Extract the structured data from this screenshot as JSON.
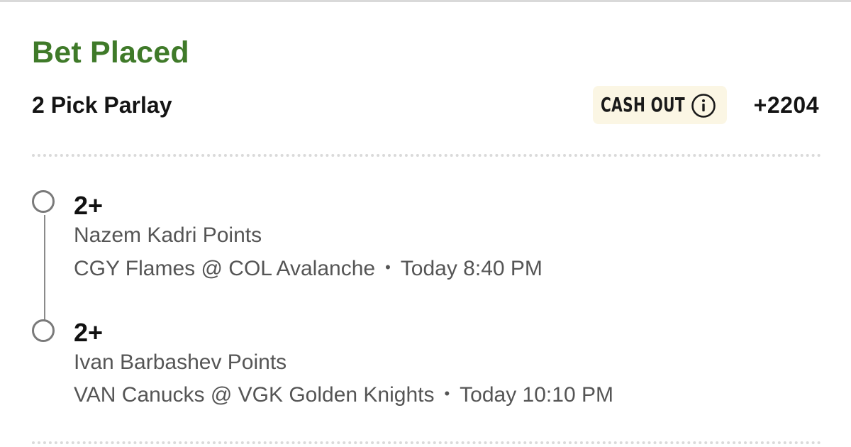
{
  "header": {
    "status": "Bet Placed",
    "bet_type": "2 Pick Parlay",
    "cash_out_label": "CASH OUT",
    "odds": "+2204"
  },
  "legs": [
    {
      "threshold": "2+",
      "market": "Nazem Kadri Points",
      "matchup": "CGY Flames @ COL Avalanche",
      "separator": "•",
      "time": "Today 8:40 PM"
    },
    {
      "threshold": "2+",
      "market": "Ivan Barbashev Points",
      "matchup": "VAN Canucks @ VGK Golden Knights",
      "separator": "•",
      "time": "Today 10:10 PM"
    }
  ],
  "colors": {
    "status_green": "#3f7a29",
    "cash_out_bg": "#fbf6e4",
    "text_primary": "#111111",
    "text_secondary": "#555555",
    "timeline_gray": "#7a7a7a"
  },
  "icons": {
    "info": "info-circle-icon",
    "leg_status": "open-circle-icon"
  }
}
